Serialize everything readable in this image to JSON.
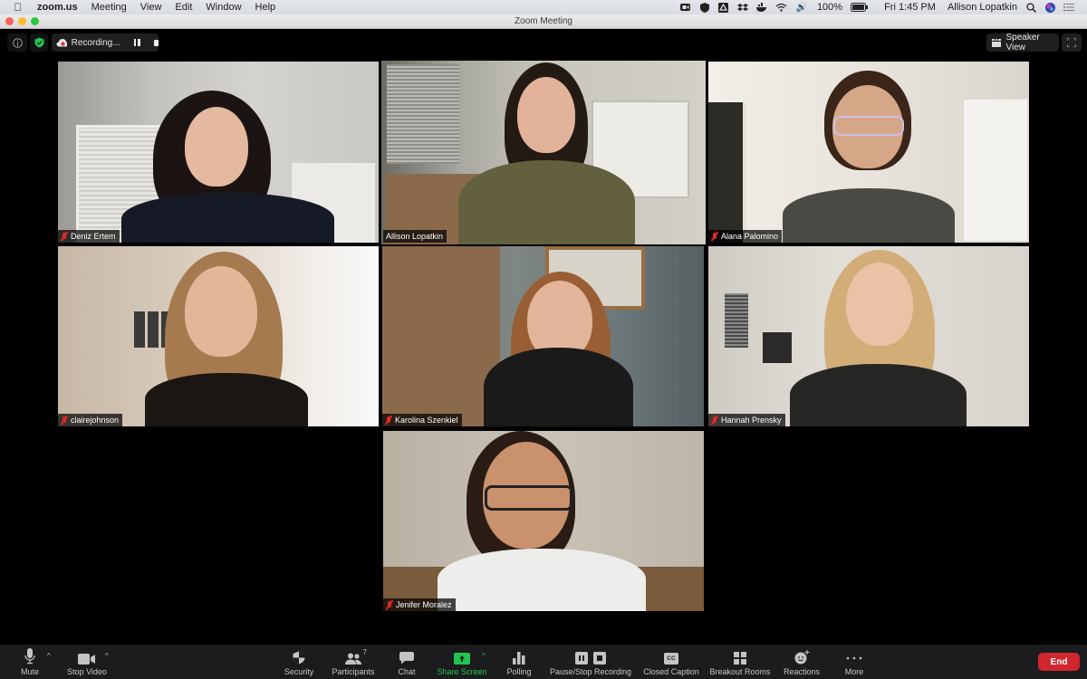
{
  "menubar": {
    "app_name": "zoom.us",
    "menus": [
      "Meeting",
      "View",
      "Edit",
      "Window",
      "Help"
    ],
    "battery": "100%",
    "clock": "Fri 1:45 PM",
    "user": "Allison Lopatkin",
    "status_icons": [
      "zoom-icon",
      "shield-icon",
      "drive-icon",
      "dropbox-icon",
      "docker-icon",
      "wifi-icon",
      "volume-icon"
    ]
  },
  "window": {
    "title": "Zoom Meeting"
  },
  "topbar": {
    "recording_label": "Recording...",
    "view_label": "Speaker View"
  },
  "participants": [
    {
      "name": "Deniz Ertem",
      "muted": true,
      "active": false
    },
    {
      "name": "Allison Lopatkin",
      "muted": false,
      "active": true
    },
    {
      "name": "Alana Palomino",
      "muted": true,
      "active": false
    },
    {
      "name": "clairejohnson",
      "muted": true,
      "active": false
    },
    {
      "name": "Karolina Szenkiel",
      "muted": true,
      "active": false
    },
    {
      "name": "Hannah Prensky",
      "muted": true,
      "active": false
    },
    {
      "name": "Jenifer Moralez",
      "muted": true,
      "active": false
    }
  ],
  "toolbar": {
    "mute": "Mute",
    "stop_video": "Stop Video",
    "security": "Security",
    "participants": "Participants",
    "participants_count": "7",
    "chat": "Chat",
    "share_screen": "Share Screen",
    "polling": "Polling",
    "pause_stop_recording": "Pause/Stop Recording",
    "closed_caption": "Closed Caption",
    "cc_glyph": "CC",
    "breakout_rooms": "Breakout Rooms",
    "reactions": "Reactions",
    "more": "More",
    "end": "End"
  },
  "colors": {
    "active_speaker_border": "#d6e67a",
    "share_green": "#23c552",
    "end_red": "#d0262e",
    "muted_red": "#e02828"
  }
}
